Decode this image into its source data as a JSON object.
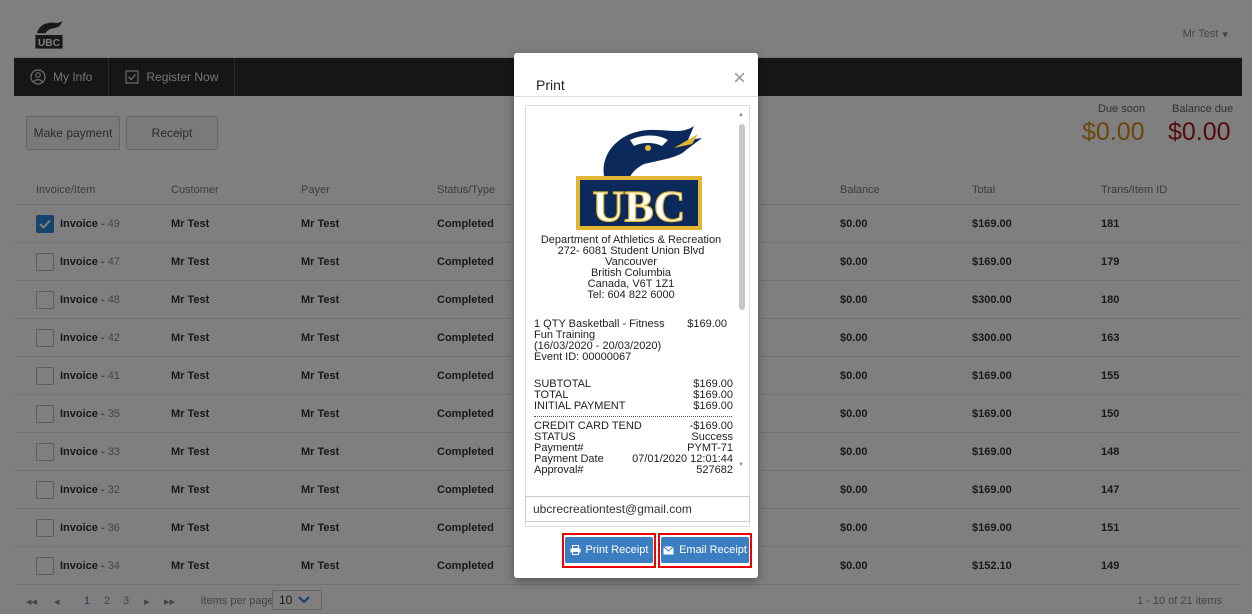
{
  "header": {
    "user": "Mr Test",
    "user_caret": "▾",
    "nav": [
      {
        "label": "My Info",
        "icon": "user-circle-icon"
      },
      {
        "label": "Register Now",
        "icon": "checkbox-icon"
      }
    ]
  },
  "actions": {
    "make_payment": "Make payment",
    "receipt": "Receipt"
  },
  "balances": {
    "due_soon_label": "Due soon",
    "due_soon_value": "$0.00",
    "balance_due_label": "Balance due",
    "balance_due_value": "$0.00"
  },
  "table": {
    "columns": [
      "Invoice/Item",
      "Customer",
      "Payer",
      "Status/Type",
      "Balance",
      "Total",
      "Trans/Item ID"
    ],
    "rows": [
      {
        "label": "Invoice",
        "num": "49",
        "checked": true,
        "customer": "Mr Test",
        "payer": "Mr Test",
        "status": "Completed",
        "balance": "$0.00",
        "total": "$169.00",
        "id": "181"
      },
      {
        "label": "Invoice",
        "num": "47",
        "checked": false,
        "customer": "Mr Test",
        "payer": "Mr Test",
        "status": "Completed",
        "balance": "$0.00",
        "total": "$169.00",
        "id": "179"
      },
      {
        "label": "Invoice",
        "num": "48",
        "checked": false,
        "customer": "Mr Test",
        "payer": "Mr Test",
        "status": "Completed",
        "balance": "$0.00",
        "total": "$300.00",
        "id": "180"
      },
      {
        "label": "Invoice",
        "num": "42",
        "checked": false,
        "customer": "Mr Test",
        "payer": "Mr Test",
        "status": "Completed",
        "balance": "$0.00",
        "total": "$300.00",
        "id": "163"
      },
      {
        "label": "Invoice",
        "num": "41",
        "checked": false,
        "customer": "Mr Test",
        "payer": "Mr Test",
        "status": "Completed",
        "balance": "$0.00",
        "total": "$169.00",
        "id": "155"
      },
      {
        "label": "Invoice",
        "num": "35",
        "checked": false,
        "customer": "Mr Test",
        "payer": "Mr Test",
        "status": "Completed",
        "balance": "$0.00",
        "total": "$169.00",
        "id": "150"
      },
      {
        "label": "Invoice",
        "num": "33",
        "checked": false,
        "customer": "Mr Test",
        "payer": "Mr Test",
        "status": "Completed",
        "balance": "$0.00",
        "total": "$169.00",
        "id": "148"
      },
      {
        "label": "Invoice",
        "num": "32",
        "checked": false,
        "customer": "Mr Test",
        "payer": "Mr Test",
        "status": "Completed",
        "balance": "$0.00",
        "total": "$169.00",
        "id": "147"
      },
      {
        "label": "Invoice",
        "num": "36",
        "checked": false,
        "customer": "Mr Test",
        "payer": "Mr Test",
        "status": "Completed",
        "balance": "$0.00",
        "total": "$169.00",
        "id": "151"
      },
      {
        "label": "Invoice",
        "num": "34",
        "checked": false,
        "customer": "Mr Test",
        "payer": "Mr Test",
        "status": "Completed",
        "balance": "$0.00",
        "total": "$152.10",
        "id": "149"
      }
    ]
  },
  "pager": {
    "first": "◂◂",
    "prev": "◂",
    "pages": [
      "1",
      "2",
      "3"
    ],
    "next": "▸",
    "last": "▸▸",
    "items_per_page_label": "items per page",
    "items_per_page_value": "10",
    "summary": "1 - 10 of 21 items"
  },
  "modal": {
    "title": "Print",
    "close": "×",
    "logo_text": "UBC",
    "receipt": {
      "org": "Department of Athletics & Recreation",
      "address": "272- 6081 Student Union Blvd",
      "city": "Vancouver",
      "province": "British Columbia",
      "country_postal": "Canada, V6T 1Z1",
      "tel": "Tel: 604 822 6000",
      "item_line1": "1 QTY Basketball - Fitness",
      "item_price": "$169.00",
      "item_line2": "Fun Training",
      "item_dates": "(16/03/2020 - 20/03/2020)",
      "event_id": "Event ID: 00000067",
      "subtotal_label": "SUBTOTAL",
      "subtotal": "$169.00",
      "total_label": "TOTAL",
      "total": "$169.00",
      "initial_label": "INITIAL PAYMENT",
      "initial": "$169.00",
      "cc_label": "CREDIT CARD TEND",
      "cc": "-$169.00",
      "status_label": "STATUS",
      "status": "Success",
      "payment_no_label": "Payment#",
      "payment_no": "PYMT-71",
      "payment_date_label": "Payment Date",
      "payment_date": "07/01/2020 12:01:44",
      "approval_label": "Approval#",
      "approval": "527682"
    },
    "email_value": "ubcrecreationtest@gmail.com",
    "print_button": "Print Receipt",
    "email_button": "Email Receipt"
  },
  "colors": {
    "due_soon": "#d98a1a",
    "balance_due": "#b0171a",
    "modal_button": "#3c7ec2",
    "highlight": "#e00000",
    "logo_blue": "#0b2a5b",
    "logo_gold": "#e2b631"
  }
}
